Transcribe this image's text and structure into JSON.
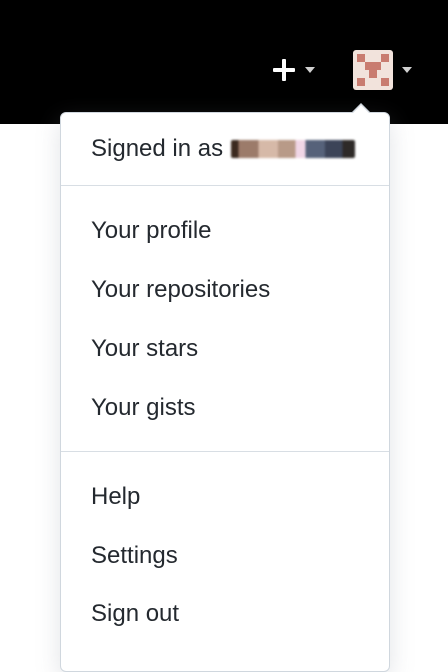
{
  "header": {
    "background": "#000000",
    "create_icon": "plus-icon",
    "create_caret_icon": "caret-down-icon",
    "avatar_icon": "avatar-icon",
    "avatar_caret_icon": "caret-down-icon"
  },
  "dropdown": {
    "signed_in_label": "Signed in as",
    "username_redacted": true,
    "section_profile": [
      {
        "label": "Your profile"
      },
      {
        "label": "Your repositories"
      },
      {
        "label": "Your stars"
      },
      {
        "label": "Your gists"
      }
    ],
    "section_account": [
      {
        "label": "Help"
      },
      {
        "label": "Settings"
      },
      {
        "label": "Sign out"
      }
    ]
  }
}
